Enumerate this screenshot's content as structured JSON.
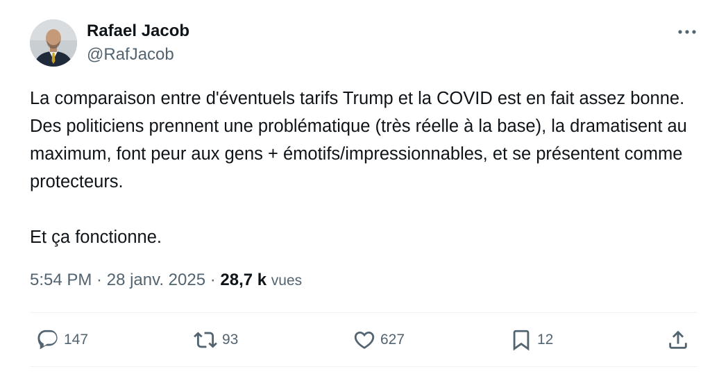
{
  "author": {
    "name": "Rafael Jacob",
    "handle": "@RafJacob",
    "avatar_icon": "profile-photo"
  },
  "more_icon": "ellipsis-icon",
  "tweet": {
    "text": "La comparaison entre d'éventuels tarifs Trump et la COVID est en fait assez bonne. Des politiciens prennent une problématique (très réelle à la base), la dramatisent au maximum, font peur aux gens + émotifs/impressionnables, et se présentent comme protecteurs.\n\nEt ça fonctionne."
  },
  "meta": {
    "time": "5:54 PM",
    "separator": " · ",
    "date": "28 janv. 2025",
    "views_count": "28,7 k",
    "views_label": "vues"
  },
  "actions": {
    "reply": {
      "icon": "reply-icon",
      "count": "147"
    },
    "retweet": {
      "icon": "retweet-icon",
      "count": "93"
    },
    "like": {
      "icon": "heart-icon",
      "count": "627"
    },
    "bookmark": {
      "icon": "bookmark-icon",
      "count": "12"
    },
    "share": {
      "icon": "share-icon"
    }
  },
  "colors": {
    "primary_text": "#0f1419",
    "secondary_text": "#536471",
    "divider": "#eff3f4",
    "background": "#ffffff"
  }
}
